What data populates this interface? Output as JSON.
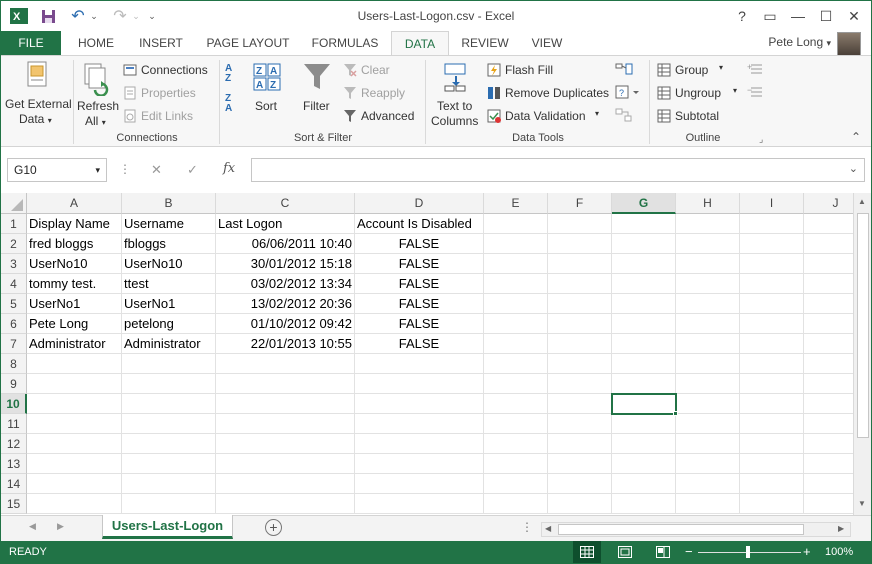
{
  "window": {
    "title": "Users-Last-Logon.csv - Excel",
    "accent": "#217346",
    "controls": {
      "help": "?",
      "ribbon_display": "▭",
      "minimize": "—",
      "maximize": "☐",
      "close": "✕"
    }
  },
  "qat": {
    "save_icon": "save-icon",
    "undo": "↶",
    "redo": "↷",
    "customize": "⌄"
  },
  "tabs": [
    "FILE",
    "HOME",
    "INSERT",
    "PAGE LAYOUT",
    "FORMULAS",
    "DATA",
    "REVIEW",
    "VIEW"
  ],
  "active_tab": "DATA",
  "user": {
    "name": "Pete Long",
    "caret": "▾"
  },
  "ribbon": {
    "get_external_data": {
      "line1": "Get External",
      "line2": "Data"
    },
    "refresh": {
      "line1": "Refresh",
      "line2": "All"
    },
    "connections": {
      "connections": "Connections",
      "properties": "Properties",
      "edit_links": "Edit Links",
      "group_label": "Connections"
    },
    "sort_filter": {
      "sort_az": "A↓Z",
      "sort_za": "Z↓A",
      "sort": "Sort",
      "filter": "Filter",
      "clear": "Clear",
      "reapply": "Reapply",
      "advanced": "Advanced",
      "group_label": "Sort & Filter"
    },
    "data_tools": {
      "text_to_columns_1": "Text to",
      "text_to_columns_2": "Columns",
      "flash_fill": "Flash Fill",
      "remove_duplicates": "Remove Duplicates",
      "data_validation": "Data Validation",
      "group_label": "Data Tools"
    },
    "outline": {
      "group": "Group",
      "ungroup": "Ungroup",
      "subtotal": "Subtotal",
      "group_label": "Outline"
    }
  },
  "formula_bar": {
    "name_box": "G10",
    "cancel": "✕",
    "enter": "✓",
    "fx": "fx",
    "value": ""
  },
  "sheet": {
    "columns": [
      "A",
      "B",
      "C",
      "D",
      "E",
      "F",
      "G",
      "H",
      "I",
      "J"
    ],
    "rows": [
      "1",
      "2",
      "3",
      "4",
      "5",
      "6",
      "7",
      "8",
      "9",
      "10",
      "11",
      "12",
      "13",
      "14",
      "15"
    ],
    "selected_cell": "G10",
    "headers": [
      "Display Name",
      "Username",
      "Last Logon",
      "Account Is Disabled"
    ],
    "data": [
      [
        "fred bloggs",
        "fbloggs",
        "06/06/2011 10:40",
        "FALSE"
      ],
      [
        "UserNo10",
        "UserNo10",
        "30/01/2012 15:18",
        "FALSE"
      ],
      [
        "tommy test.",
        "ttest",
        "03/02/2012 13:34",
        "FALSE"
      ],
      [
        "UserNo1",
        "UserNo1",
        "13/02/2012 20:36",
        "FALSE"
      ],
      [
        "Pete Long",
        "petelong",
        "01/10/2012 09:42",
        "FALSE"
      ],
      [
        "Administrator",
        "Administrator",
        "22/01/2013 10:55",
        "FALSE"
      ]
    ]
  },
  "sheet_tabs": {
    "active": "Users-Last-Logon",
    "add": "+"
  },
  "status_bar": {
    "ready": "READY",
    "zoom": "100%",
    "zoom_minus": "−",
    "zoom_plus": "+"
  }
}
